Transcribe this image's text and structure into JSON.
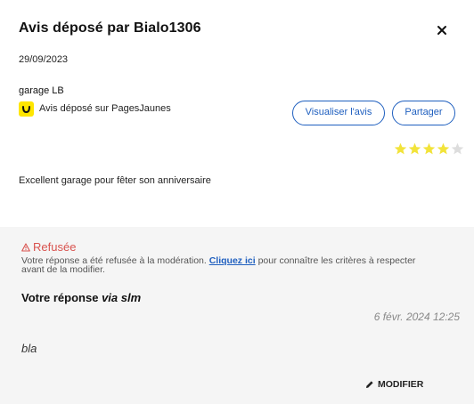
{
  "header": {
    "title": "Avis déposé par Bialo1306"
  },
  "review": {
    "date": "29/09/2023",
    "business": "garage LB",
    "source": "Avis déposé sur PagesJaunes",
    "rating": 4,
    "rating_max": 5,
    "text": "Excellent garage pour fêter son anniversaire"
  },
  "actions": {
    "visualiser_label": "Visualiser l'avis",
    "partager_label": "Partager"
  },
  "reply": {
    "status_label": "Refusée",
    "status_msg_before": "Votre réponse a été refusée à la modération. ",
    "status_link": "Cliquez ici",
    "status_msg_after": " pour connaître les critères à respecter avant de la modifier.",
    "heading_prefix": "Votre réponse ",
    "heading_via": "via slm",
    "date": "6 févr. 2024 12:25",
    "text": "bla",
    "modify_label": "MODIFIER"
  },
  "colors": {
    "accent": "#1f5fbf",
    "star_filled": "#f2e33a",
    "star_empty": "#dddddd",
    "refused": "#d9534f",
    "pj_yellow": "#ffe600"
  }
}
